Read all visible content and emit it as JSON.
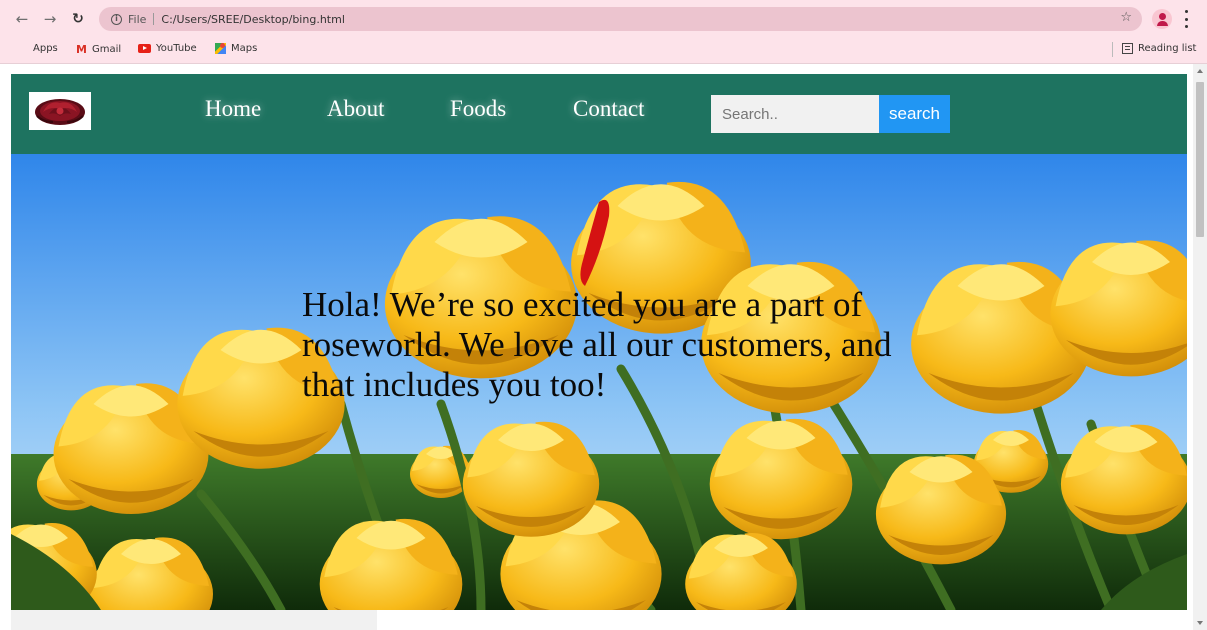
{
  "browser": {
    "url_scheme": "File",
    "url": "C:/Users/SREE/Desktop/bing.html",
    "bookmarks": [
      {
        "label": "Apps",
        "icon": "apps-grid-icon"
      },
      {
        "label": "Gmail",
        "icon": "gmail-icon"
      },
      {
        "label": "YouTube",
        "icon": "youtube-icon"
      },
      {
        "label": "Maps",
        "icon": "maps-icon"
      }
    ],
    "reading_list": "Reading list",
    "colors": {
      "chrome_bg": "#fde3ea",
      "omnibox_bg": "#ecc4cf"
    }
  },
  "site": {
    "nav": {
      "links": [
        "Home",
        "About",
        "Foods",
        "Contact"
      ],
      "search_placeholder": "Search..",
      "search_button": "search",
      "bg_color": "#1e7360"
    },
    "hero": {
      "message": "Hola! We’re so excited you are a part of roseworld. We love all our customers, and that includes you too!"
    },
    "search_button_color": "#2196f3"
  }
}
